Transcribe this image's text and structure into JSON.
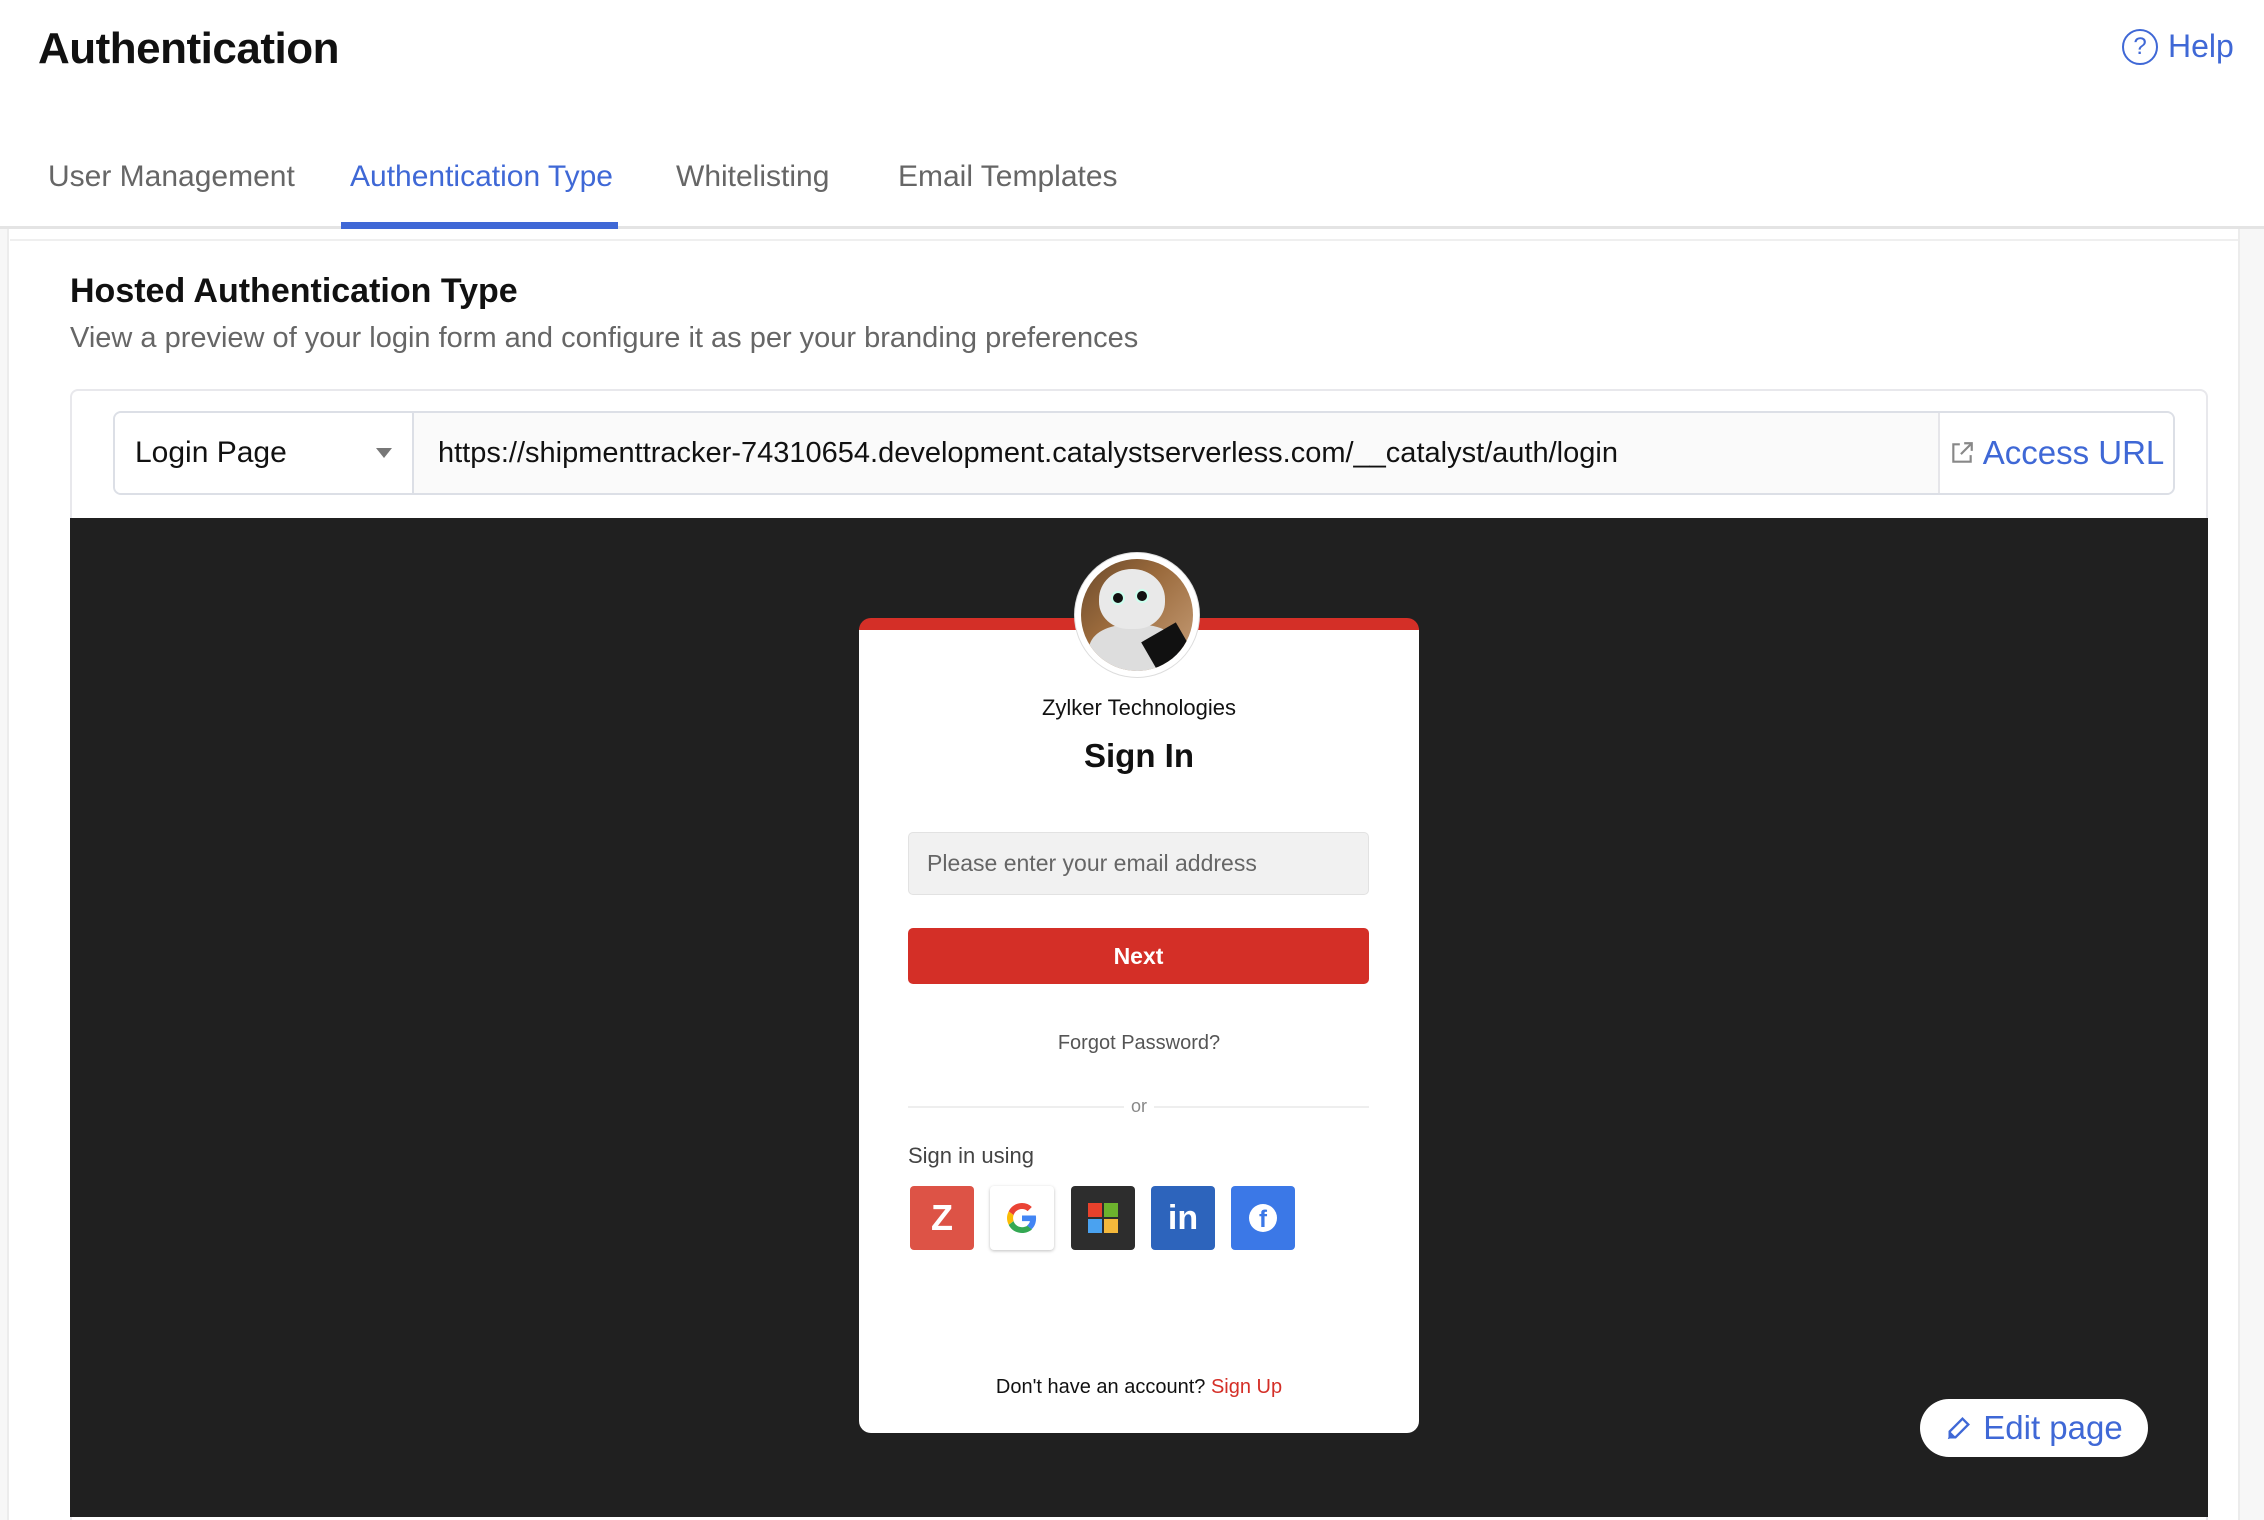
{
  "header": {
    "title": "Authentication",
    "help_label": "Help",
    "help_icon": "question-circle-icon"
  },
  "tabs": [
    {
      "label": "User Management",
      "active": false
    },
    {
      "label": "Authentication Type",
      "active": true
    },
    {
      "label": "Whitelisting",
      "active": false
    },
    {
      "label": "Email Templates",
      "active": false
    }
  ],
  "section": {
    "title": "Hosted Authentication Type",
    "subtitle": "View a preview of your login form and configure it as per your branding preferences"
  },
  "controls": {
    "page_select_value": "Login Page",
    "url": "https://shipmenttracker-74310654.development.catalystserverless.com/__catalyst/auth/login",
    "access_url_label": "Access URL",
    "access_url_icon": "external-link-icon"
  },
  "preview": {
    "company_name": "Zylker Technologies",
    "title": "Sign In",
    "email_placeholder": "Please enter your email address",
    "next_label": "Next",
    "forgot_password": "Forgot Password?",
    "divider_label": "or",
    "sign_in_using": "Sign in using",
    "social_providers": [
      {
        "name": "Zoho",
        "glyph": "Z",
        "color": "#dd5346"
      },
      {
        "name": "Google",
        "glyph": "G",
        "color": "#ffffff"
      },
      {
        "name": "Microsoft",
        "glyph": "",
        "color": "#2d2d2d"
      },
      {
        "name": "LinkedIn",
        "glyph": "in",
        "color": "#2d64bc"
      },
      {
        "name": "Facebook",
        "glyph": "f",
        "color": "#3b78e7"
      }
    ],
    "no_account_text": "Don't have an account?",
    "signup_label": "Sign Up",
    "accent_color": "#d42f27"
  },
  "edit_page_label": "Edit page",
  "colors": {
    "brand_blue": "#3f68d6",
    "preview_background": "#202020"
  }
}
